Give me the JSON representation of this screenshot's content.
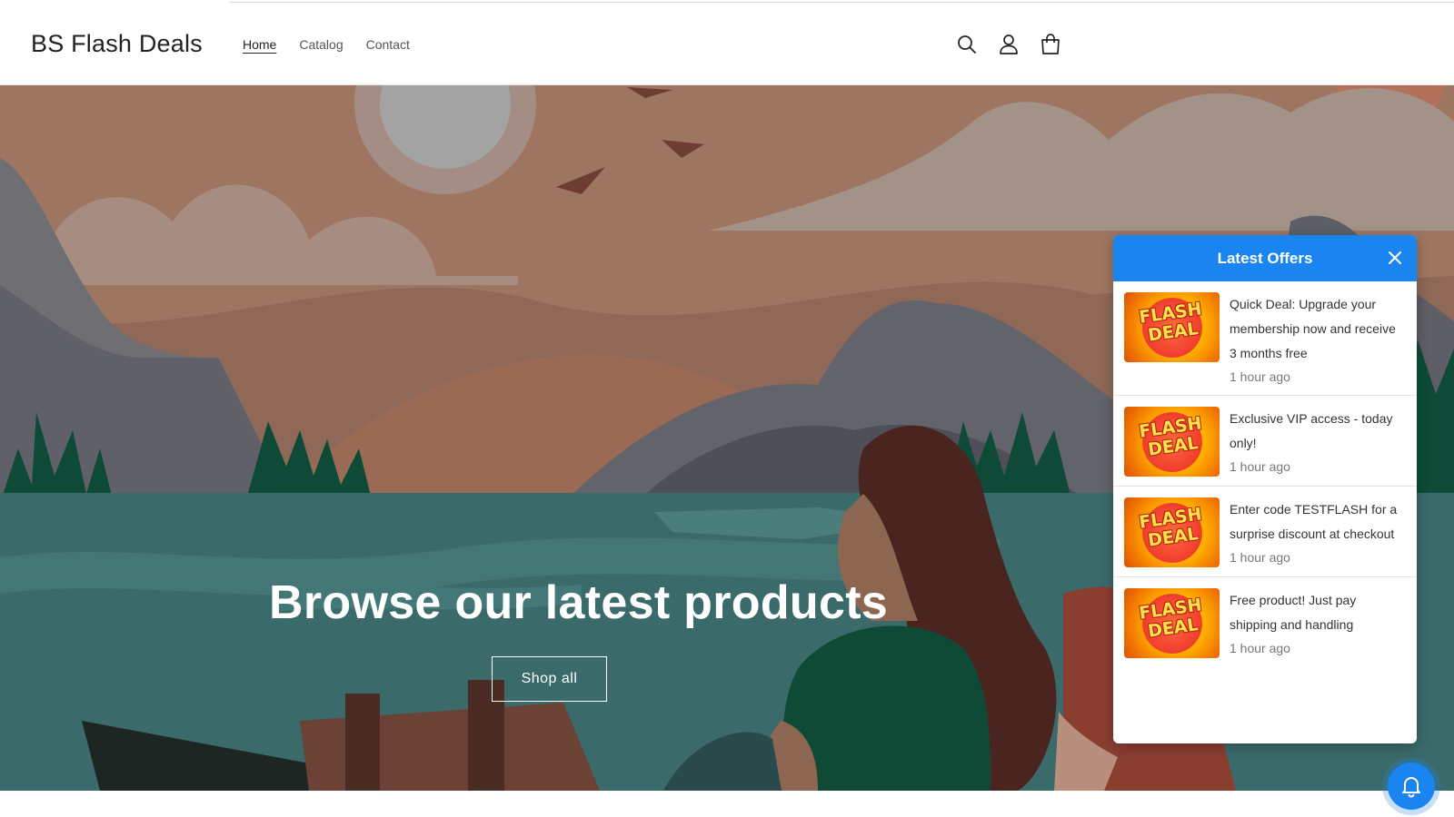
{
  "header": {
    "brand": "BS Flash Deals",
    "nav": [
      {
        "label": "Home",
        "active": true
      },
      {
        "label": "Catalog",
        "active": false
      },
      {
        "label": "Contact",
        "active": false
      }
    ],
    "icons": [
      "search-icon",
      "account-icon",
      "cart-icon"
    ]
  },
  "hero": {
    "title": "Browse our latest products",
    "button_label": "Shop all"
  },
  "offers_panel": {
    "title": "Latest Offers",
    "accent": "#1a84f0",
    "thumb_label_line1": "FLASH",
    "thumb_label_line2": "DEAL",
    "items": [
      {
        "text": "Quick Deal: Upgrade your membership now and receive 3 months free",
        "time": "1 hour ago"
      },
      {
        "text": "Exclusive VIP access - today only!",
        "time": "1 hour ago"
      },
      {
        "text": "Enter code TESTFLASH for a surprise discount at checkout",
        "time": "1 hour ago"
      },
      {
        "text": "Free product! Just pay shipping and handling",
        "time": "1 hour ago"
      }
    ]
  }
}
